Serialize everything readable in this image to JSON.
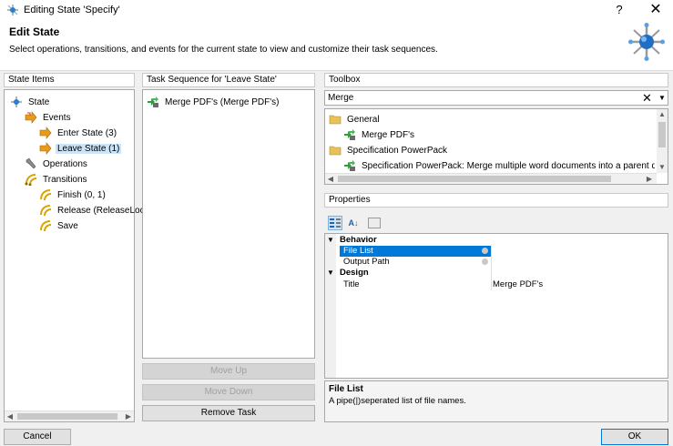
{
  "window": {
    "title": "Editing State 'Specify'",
    "help_label": "?",
    "close_label": "✕"
  },
  "header": {
    "title": "Edit State",
    "description": "Select operations, transitions, and events for the current state to view and customize their task sequences."
  },
  "state_items": {
    "title": "State Items",
    "tree": [
      {
        "label": "State",
        "icon": "state-icon"
      },
      {
        "label": "Events",
        "icon": "events-icon"
      },
      {
        "label": "Enter State (3)",
        "icon": "event-icon"
      },
      {
        "label": "Leave State (1)",
        "icon": "event-icon",
        "selected": true
      },
      {
        "label": "Operations",
        "icon": "wrench-icon"
      },
      {
        "label": "Transitions",
        "icon": "transitions-icon"
      },
      {
        "label": "Finish (0, 1)",
        "icon": "transition-icon"
      },
      {
        "label": "Release (ReleaseLoc",
        "icon": "transition-icon"
      },
      {
        "label": "Save",
        "icon": "transition-icon"
      }
    ]
  },
  "task_sequence": {
    "title": "Task Sequence for 'Leave State'",
    "items": [
      {
        "label": "Merge PDF's (Merge PDF's)",
        "icon": "merge-pdf-icon"
      }
    ],
    "buttons": {
      "move_up": "Move Up",
      "move_down": "Move Down",
      "remove_task": "Remove Task"
    }
  },
  "toolbox": {
    "title": "Toolbox",
    "search": {
      "value": "Merge",
      "placeholder": ""
    },
    "tree": [
      {
        "label": "General",
        "icon": "folder-icon"
      },
      {
        "label": "Merge PDF's",
        "icon": "merge-pdf-icon"
      },
      {
        "label": "Specification PowerPack",
        "icon": "folder-icon"
      },
      {
        "label": "Specification PowerPack: Merge multiple word documents into a parent docum",
        "icon": "merge-pdf-icon"
      }
    ]
  },
  "properties": {
    "title": "Properties",
    "categories": [
      {
        "name": "Behavior",
        "rows": [
          {
            "name": "File List",
            "value": "",
            "selected": true
          },
          {
            "name": "Output Path",
            "value": ""
          }
        ]
      },
      {
        "name": "Design",
        "rows": [
          {
            "name": "Title",
            "value": "Merge PDF's"
          }
        ]
      }
    ],
    "description": {
      "title": "File List",
      "text": "A pipe(|)seperated list of file names."
    }
  },
  "footer": {
    "cancel_label": "Cancel",
    "ok_label": "OK"
  },
  "colors": {
    "selection": "#0078d7",
    "light_selection": "#cce4f7",
    "folder": "#e8c15a",
    "event_orange": "#e89a1a",
    "transition_yellow": "#d9a400",
    "state_blue": "#2a7fd4"
  }
}
